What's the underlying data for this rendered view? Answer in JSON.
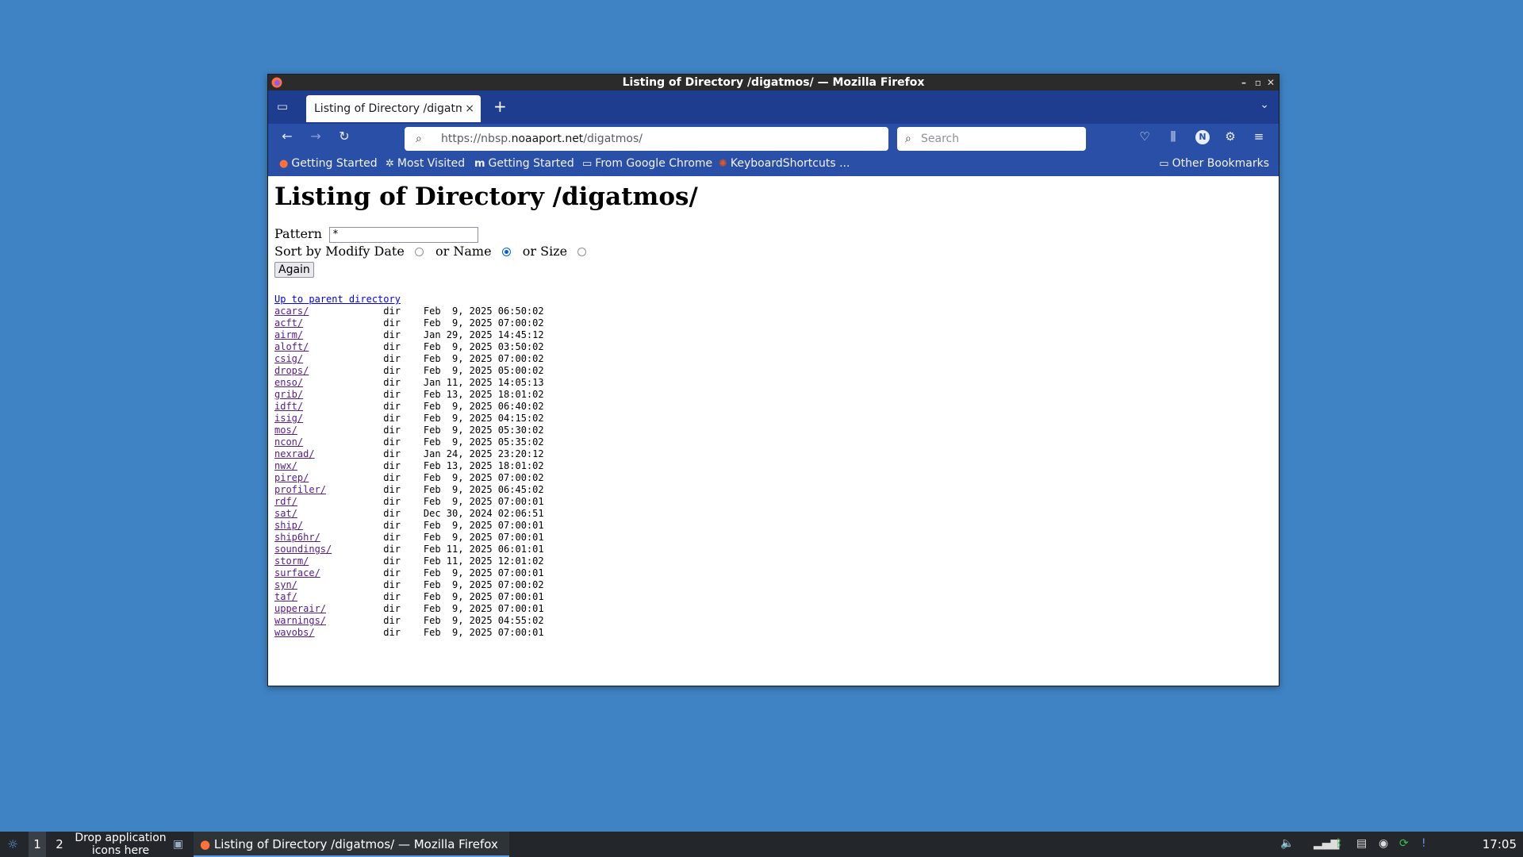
{
  "window": {
    "title": "Listing of Directory /digatmos/ — Mozilla Firefox"
  },
  "tab": {
    "label": "Listing of Directory /digatmos/",
    "close": "×"
  },
  "urlbar": {
    "scheme_prefix": "https://nbsp.",
    "host": "noaaport.net",
    "path": "/digatmos/"
  },
  "searchbar": {
    "placeholder": "Search"
  },
  "bookmarks": [
    {
      "label": "Getting Started",
      "icon": "firefox-icon"
    },
    {
      "label": "Most Visited",
      "icon": "gear-icon"
    },
    {
      "label": "Getting Started",
      "icon": "m-icon"
    },
    {
      "label": "From Google Chrome",
      "icon": "folder-icon"
    },
    {
      "label": "KeyboardShortcuts ...",
      "icon": "ubuntu-icon"
    }
  ],
  "other_bookmarks": "Other Bookmarks",
  "page": {
    "heading": "Listing of Directory /digatmos/",
    "pattern_label": "Pattern",
    "pattern_value": "*",
    "sort_label": "Sort by Modify Date",
    "or_name": "or Name",
    "or_size": "or Size",
    "sort_selected": "name",
    "again": "Again",
    "parent_link": "Up to parent directory",
    "entries": [
      {
        "name": "acars/",
        "type": "dir",
        "date": "Feb  9, 2025 06:50:02"
      },
      {
        "name": "acft/",
        "type": "dir",
        "date": "Feb  9, 2025 07:00:02"
      },
      {
        "name": "airm/",
        "type": "dir",
        "date": "Jan 29, 2025 14:45:12"
      },
      {
        "name": "aloft/",
        "type": "dir",
        "date": "Feb  9, 2025 03:50:02"
      },
      {
        "name": "csig/",
        "type": "dir",
        "date": "Feb  9, 2025 07:00:02"
      },
      {
        "name": "drops/",
        "type": "dir",
        "date": "Feb  9, 2025 05:00:02"
      },
      {
        "name": "enso/",
        "type": "dir",
        "date": "Jan 11, 2025 14:05:13"
      },
      {
        "name": "grib/",
        "type": "dir",
        "date": "Feb 13, 2025 18:01:02"
      },
      {
        "name": "idft/",
        "type": "dir",
        "date": "Feb  9, 2025 06:40:02"
      },
      {
        "name": "isig/",
        "type": "dir",
        "date": "Feb  9, 2025 04:15:02"
      },
      {
        "name": "mos/",
        "type": "dir",
        "date": "Feb  9, 2025 05:30:02"
      },
      {
        "name": "ncon/",
        "type": "dir",
        "date": "Feb  9, 2025 05:35:02"
      },
      {
        "name": "nexrad/",
        "type": "dir",
        "date": "Jan 24, 2025 23:20:12"
      },
      {
        "name": "nwx/",
        "type": "dir",
        "date": "Feb 13, 2025 18:01:02"
      },
      {
        "name": "pirep/",
        "type": "dir",
        "date": "Feb  9, 2025 07:00:02"
      },
      {
        "name": "profiler/",
        "type": "dir",
        "date": "Feb  9, 2025 06:45:02"
      },
      {
        "name": "rdf/",
        "type": "dir",
        "date": "Feb  9, 2025 07:00:01"
      },
      {
        "name": "sat/",
        "type": "dir",
        "date": "Dec 30, 2024 02:06:51"
      },
      {
        "name": "ship/",
        "type": "dir",
        "date": "Feb  9, 2025 07:00:01"
      },
      {
        "name": "ship6hr/",
        "type": "dir",
        "date": "Feb  9, 2025 07:00:01"
      },
      {
        "name": "soundings/",
        "type": "dir",
        "date": "Feb 11, 2025 06:01:01"
      },
      {
        "name": "storm/",
        "type": "dir",
        "date": "Feb 11, 2025 12:01:02"
      },
      {
        "name": "surface/",
        "type": "dir",
        "date": "Feb  9, 2025 07:00:01"
      },
      {
        "name": "syn/",
        "type": "dir",
        "date": "Feb  9, 2025 07:00:02"
      },
      {
        "name": "taf/",
        "type": "dir",
        "date": "Feb  9, 2025 07:00:01"
      },
      {
        "name": "upperair/",
        "type": "dir",
        "date": "Feb  9, 2025 07:00:01"
      },
      {
        "name": "warnings/",
        "type": "dir",
        "date": "Feb  9, 2025 04:55:02"
      },
      {
        "name": "wavobs/",
        "type": "dir",
        "date": "Feb  9, 2025 07:00:01"
      }
    ]
  },
  "taskbar": {
    "workspace_1": "1",
    "workspace_2": "2",
    "drop_line1": "Drop application",
    "drop_line2": "icons here",
    "task": "Listing of Directory /digatmos/ — Mozilla Firefox",
    "clock": "17:05"
  },
  "colors": {
    "desktop": "#3f83c4",
    "tabbar": "#1f3d8f",
    "toolbar": "#2a4fa6",
    "link": "#551a8b"
  }
}
